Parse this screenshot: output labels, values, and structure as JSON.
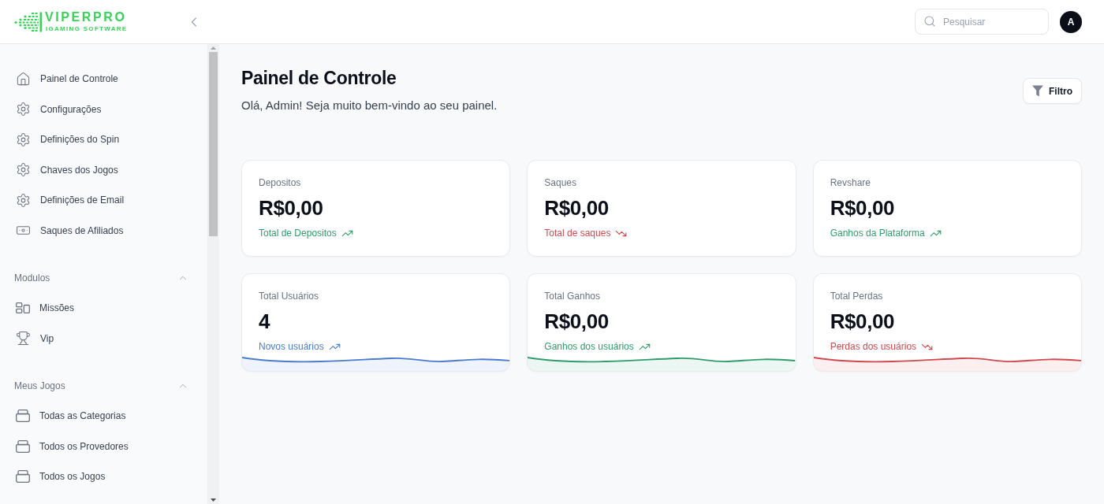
{
  "header": {
    "logo": {
      "name": "VIPERPRO",
      "tagline": "IGAMING SOFTWARE"
    },
    "search": {
      "placeholder": "Pesquisar"
    },
    "avatar": {
      "initial": "A"
    }
  },
  "sidebar": {
    "items": [
      {
        "label": "Painel de Controle",
        "kind": "home"
      },
      {
        "label": "Configurações",
        "kind": "settings"
      },
      {
        "label": "Definições do Spin",
        "kind": "settings"
      },
      {
        "label": "Chaves dos Jogos",
        "kind": "settings"
      },
      {
        "label": "Definições de Email",
        "kind": "settings"
      },
      {
        "label": "Saques de Afiliados",
        "kind": "payout"
      }
    ],
    "sections": [
      {
        "title": "Modulos",
        "expanded": true,
        "items": [
          {
            "label": "Missões",
            "kind": "missions"
          },
          {
            "label": "Vip",
            "kind": "trophy"
          }
        ]
      },
      {
        "title": "Meus Jogos",
        "expanded": true,
        "items": [
          {
            "label": "Todas as Categorias",
            "kind": "category"
          },
          {
            "label": "Todos os Provedores",
            "kind": "category"
          },
          {
            "label": "Todos os Jogos",
            "kind": "category"
          }
        ]
      }
    ]
  },
  "page": {
    "title": "Painel de Controle",
    "subtitle": "Olá, Admin! Seja muito bem-vindo ao seu painel.",
    "filter_button": "Filtro"
  },
  "cards": [
    {
      "kind": "plain",
      "label": "Depositos",
      "value": "R$0,00",
      "caption": "Total de Depositos",
      "rising": true,
      "color": "#2f9d6b"
    },
    {
      "kind": "plain",
      "label": "Saques",
      "value": "R$0,00",
      "caption": "Total de saques",
      "rising": false,
      "color": "#cf4a4f"
    },
    {
      "kind": "plain",
      "label": "Revshare",
      "value": "R$0,00",
      "caption": "Ganhos da Plataforma",
      "rising": true,
      "color": "#2f9d6b"
    },
    {
      "kind": "sparkline",
      "label": "Total Usuários",
      "value": "4",
      "caption": "Novos usuários",
      "rising": true,
      "color": "#4a7bcf"
    },
    {
      "kind": "sparkline",
      "label": "Total Ganhos",
      "value": "R$0,00",
      "caption": "Ganhos dos usuários",
      "rising": true,
      "color": "#2f9d6b"
    },
    {
      "kind": "sparkline",
      "label": "Total Perdas",
      "value": "R$0,00",
      "caption": "Perdas dos usuários",
      "rising": false,
      "color": "#cf4a4f"
    }
  ]
}
